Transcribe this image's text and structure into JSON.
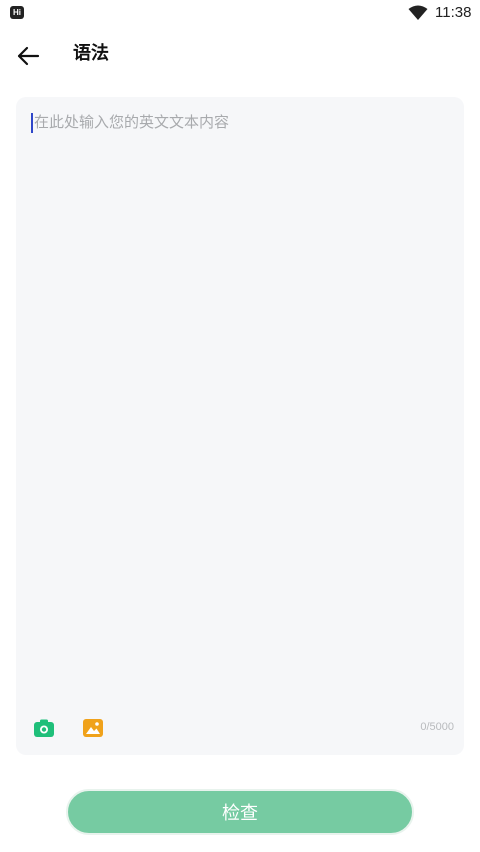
{
  "status_bar": {
    "left_icon_text": "Hi",
    "time": "11:38"
  },
  "header": {
    "title": "语法"
  },
  "editor": {
    "placeholder": "在此处输入您的英文文本内容",
    "value": "",
    "char_count": "0/5000"
  },
  "toolbar": {
    "camera_icon": "camera-icon",
    "image_icon": "image-icon"
  },
  "actions": {
    "check_label": "检查"
  },
  "colors": {
    "accent_green": "#76cba2",
    "camera_green": "#1fbf7a",
    "image_orange": "#f0a21b",
    "card_bg": "#f6f7f9",
    "cursor_blue": "#2f47c9"
  }
}
